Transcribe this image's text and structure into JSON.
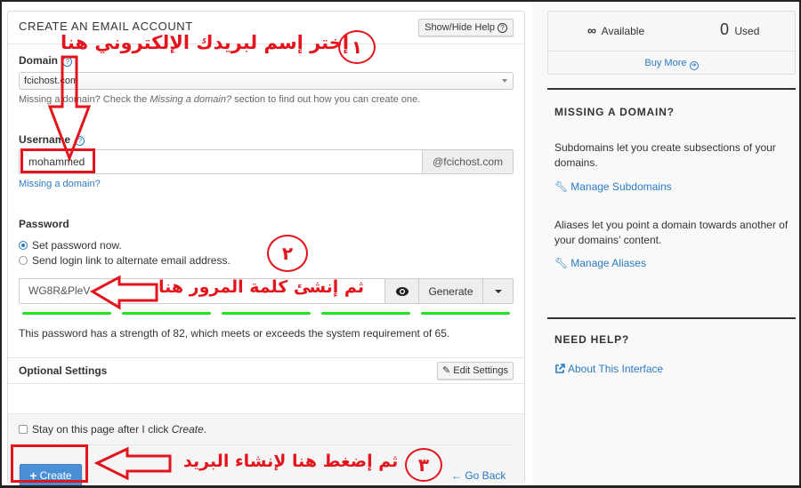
{
  "create_panel": {
    "title": "CREATE AN EMAIL ACCOUNT",
    "show_hide_help": "Show/Hide Help",
    "domain": {
      "label": "Domain",
      "selected": "fcichost.com",
      "help_prefix": "Missing a domain? Check the ",
      "help_em": "Missing a domain?",
      "help_suffix": " section to find out how you can create one."
    },
    "username": {
      "label": "Username",
      "value": "mohammed",
      "suffix": "@fcichost.com",
      "missing_link": "Missing a domain?"
    },
    "password": {
      "label": "Password",
      "options": [
        {
          "label": "Set password now.",
          "selected": true
        },
        {
          "label": "Send login link to alternate email address.",
          "selected": false
        }
      ],
      "value": "WG8R&PleV",
      "generate_label": "Generate",
      "strength_segments_filled": 5,
      "strength_segments_total": 5,
      "strength_text": "This password has a strength of 82, which meets or exceeds the system requirement of 65."
    },
    "optional_settings": {
      "title": "Optional Settings",
      "edit_label": "Edit Settings"
    },
    "footer": {
      "stay_prefix": "Stay on this page after I click ",
      "stay_em": "Create",
      "stay_suffix": ".",
      "stay_checked": false,
      "create_label": "Create",
      "go_back_label": "Go Back"
    }
  },
  "stats": {
    "available_symbol": "∞",
    "available_label": "Available",
    "used_value": "0",
    "used_label": "Used",
    "buy_more": "Buy More"
  },
  "missing_domain": {
    "title": "MISSING A DOMAIN?",
    "subdomains_text": "Subdomains let you create subsections of your domains.",
    "subdomains_link": "Manage Subdomains",
    "aliases_text": "Aliases let you point a domain towards another of your domains’ content.",
    "aliases_link": "Manage Aliases"
  },
  "need_help": {
    "title": "NEED HELP?",
    "link": "About This Interface"
  },
  "annotations": {
    "step1_number": "١",
    "step1_text": "إختر إسم لبريدك الإلكتروني هنا",
    "step2_number": "٢",
    "step2_text": "ثم إنشئ كلمة المرور هنا",
    "step3_number": "٣",
    "step3_text": "ثم إضغط هنا لإنشاء البريد",
    "color": "#e3141c"
  },
  "colors": {
    "accent": "#2a7ac5",
    "primary_button": "#4a90d6",
    "strength_bar": "#22e322"
  }
}
